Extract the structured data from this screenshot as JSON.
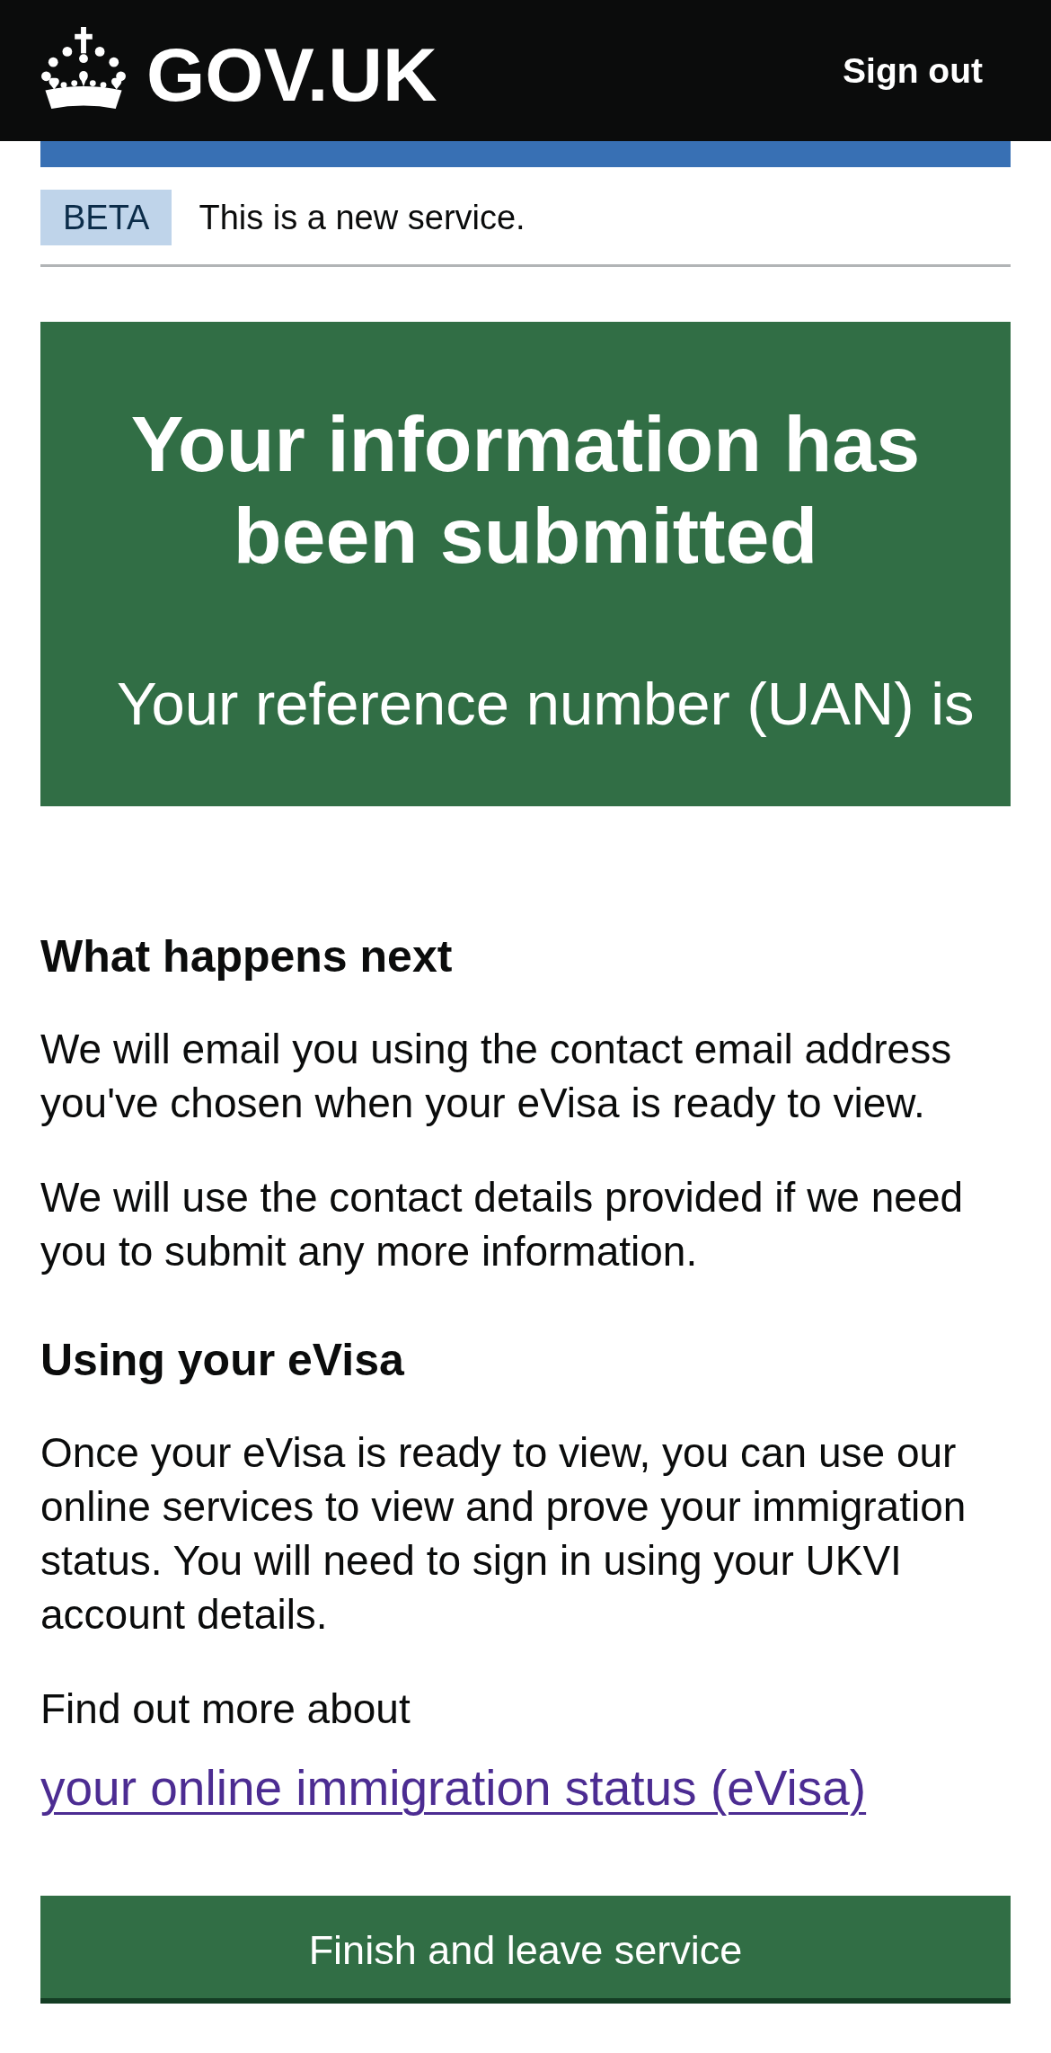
{
  "header": {
    "logo_text": "GOV.UK",
    "sign_out_link": "Sign out"
  },
  "phase_banner": {
    "tag": "BETA",
    "text": "This is a new service."
  },
  "confirmation_panel": {
    "title": "Your information has been submitted",
    "body": "Your reference number (UAN) is"
  },
  "sections": [
    {
      "heading": "What happens next",
      "paragraphs": [
        "We will email you using the contact email address you've chosen when your eVisa is ready to view.",
        "We will use the contact details provided if we need you to submit any more information."
      ]
    },
    {
      "heading": "Using your eVisa",
      "paragraphs": [
        "Once your eVisa is ready to view, you can use our online services to view and prove your immigration status. You will need to sign in using your UKVI account details."
      ]
    }
  ],
  "more_info": {
    "text": "Find out more about",
    "link": "your online immigration status (eVisa)"
  },
  "primary_button": {
    "label": "Finish and leave service"
  }
}
